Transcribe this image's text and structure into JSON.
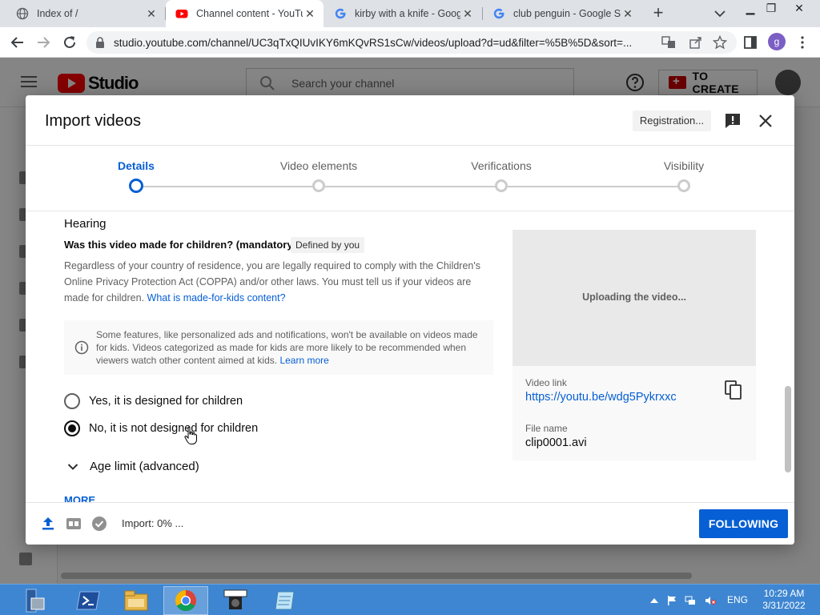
{
  "browser": {
    "tabs": [
      {
        "title": "Index of /",
        "icon": "globe-icon",
        "active": false
      },
      {
        "title": "Channel content - YouTube",
        "icon": "youtube-icon",
        "active": true
      },
      {
        "title": "kirby with a knife - Google",
        "icon": "google-icon",
        "active": false
      },
      {
        "title": "club penguin - Google Search",
        "icon": "google-icon",
        "active": false
      }
    ],
    "new_tab_label": "+",
    "url": "studio.youtube.com/channel/UC3qTxQIUvIKY6mKQvRS1sCw/videos/upload?d=ud&filter=%5B%5D&sort=...",
    "profile_initial": "g"
  },
  "studio": {
    "logo_text": "Studio",
    "search_placeholder": "Search your channel",
    "create_label": "TO CREATE"
  },
  "modal": {
    "title": "Import videos",
    "registration_label": "Registration...",
    "steps": [
      {
        "label": "Details",
        "current": true
      },
      {
        "label": "Video elements",
        "current": false
      },
      {
        "label": "Verifications",
        "current": false
      },
      {
        "label": "Visibility",
        "current": false
      }
    ],
    "section_title": "Hearing",
    "question": "Was this video made for children? (mandatory)",
    "question_badge": "Defined by you",
    "description": "Regardless of your country of residence, you are legally required to comply with the Children's Online Privacy Protection Act (COPPA) and/or other laws. You must tell us if your videos are made for children.",
    "description_link": "What is made-for-kids content?",
    "info_text": "Some features, like personalized ads and notifications, won't be available on videos made for kids. Videos categorized as made for kids are more likely to be recommended when viewers watch other content aimed at kids.",
    "info_link": "Learn more",
    "options": [
      {
        "label": "Yes, it is designed for children",
        "selected": false
      },
      {
        "label": "No, it is not designed for children",
        "selected": true
      }
    ],
    "age_limit_label": "Age limit (advanced)",
    "more_label": "MORE",
    "preview": {
      "status": "Uploading the video...",
      "video_link_label": "Video link",
      "video_link": "https://youtu.be/wdg5Pykrxxc",
      "file_name_label": "File name",
      "file_name": "clip0001.avi"
    },
    "footer": {
      "status": "Import: 0% ...",
      "next_label": "FOLLOWING"
    }
  },
  "taskbar": {
    "language": "ENG",
    "time": "10:29 AM",
    "date": "3/31/2022"
  },
  "colors": {
    "accent_blue": "#065fd4",
    "youtube_red": "#ff0000",
    "taskbar_blue": "#3e86d1"
  }
}
